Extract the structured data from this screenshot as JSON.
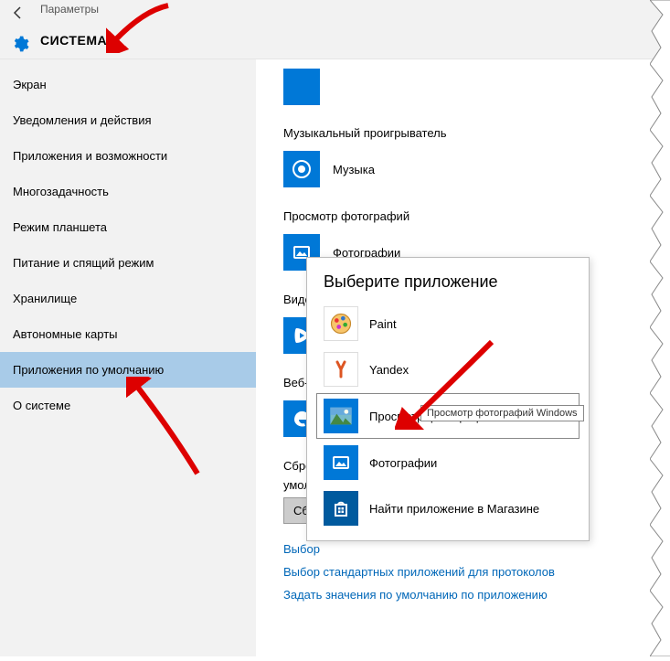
{
  "header": {
    "breadcrumb": "Параметры",
    "title": "СИСТЕМА"
  },
  "sidebar": {
    "items": [
      {
        "label": "Экран"
      },
      {
        "label": "Уведомления и действия"
      },
      {
        "label": "Приложения и возможности"
      },
      {
        "label": "Многозадачность"
      },
      {
        "label": "Режим планшета"
      },
      {
        "label": "Питание и спящий режим"
      },
      {
        "label": "Хранилище"
      },
      {
        "label": "Автономные карты"
      },
      {
        "label": "Приложения по умолчанию"
      },
      {
        "label": "О системе"
      }
    ],
    "selectedIndex": 8
  },
  "content": {
    "music_head": "Музыкальный проигрыватель",
    "music_app": "Музыка",
    "photo_head": "Просмотр фотографий",
    "photo_app": "Фотографии",
    "video_head_trunc": "Видес",
    "web_head_trunc": "Веб-б",
    "reset_line1": "Сброс",
    "reset_line2": "умолч",
    "reset_btn": "Сбр",
    "link_trunc": "Выбор",
    "link_protocols": "Выбор стандартных приложений для протоколов",
    "link_by_app": "Задать значения по умолчанию по приложению"
  },
  "popup": {
    "title": "Выберите приложение",
    "items": [
      {
        "label": "Paint"
      },
      {
        "label": "Yandex"
      },
      {
        "label": "Просмотр фотографий Windows"
      },
      {
        "label": "Фотографии"
      },
      {
        "label": "Найти приложение в Магазине"
      }
    ],
    "tooltip": "Просмотр фотографий Windows"
  },
  "colors": {
    "accent": "#0078d7",
    "link": "#0067b8",
    "sidebar_selected": "#a8cbe8"
  }
}
